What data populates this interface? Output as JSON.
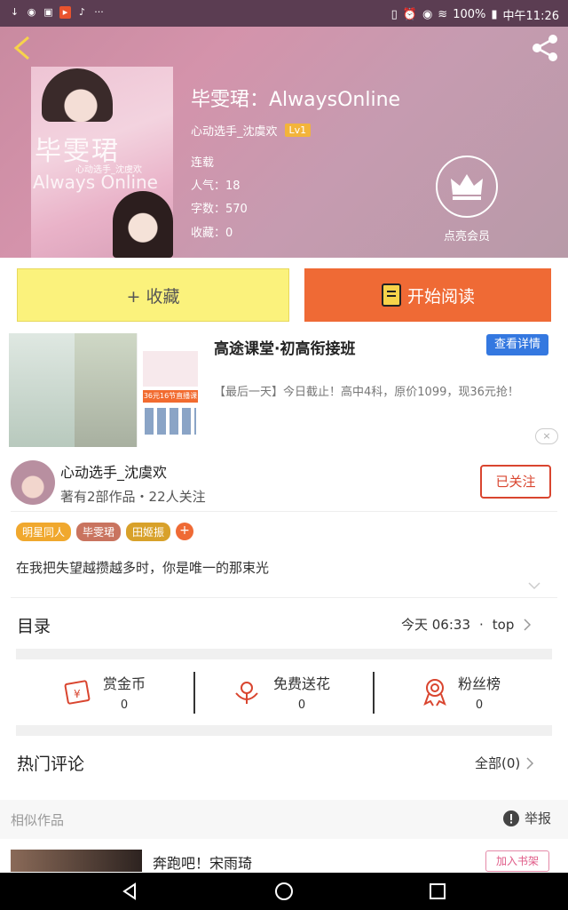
{
  "status_bar": {
    "battery": "100%",
    "time": "中午11:26",
    "more": "···"
  },
  "book": {
    "cover_text_main": "毕雯珺",
    "cover_text_sub": "心动选手_沈虞欢",
    "cover_text_en": "Always Online",
    "title": "毕雯珺：AlwaysOnline",
    "author": "心动选手_沈虞欢",
    "level": "Lv1",
    "status": "连载",
    "popularity": "人气：18",
    "word_count": "字数：570",
    "collections": "收藏：0"
  },
  "vip": {
    "label": "点亮会员"
  },
  "actions": {
    "collect_label": "+ 收藏",
    "read_label": "开始阅读"
  },
  "ad": {
    "title": "高途课堂·初高衔接班",
    "button": "查看详情",
    "description": "【最后一天】今日截止！高中4科，原价1099，现36元抢！",
    "close": "×",
    "banner_price": "36元16节直播课"
  },
  "author_card": {
    "name": "心动选手_沈虞欢",
    "stats": "著有2部作品・22人关注",
    "follow_label": "已关注"
  },
  "tags": [
    {
      "label": "明星同人",
      "color": "#f0a82e"
    },
    {
      "label": "毕雯珺",
      "color": "#c9745f"
    },
    {
      "label": "田姬振",
      "color": "#d8a12a"
    }
  ],
  "intro": "在我把失望越攒越多时，你是唯一的那束光",
  "toc": {
    "title": "目录",
    "updated": "今天 06:33",
    "dot": "·",
    "latest": "top"
  },
  "stats": [
    {
      "label": "赏金币",
      "value": "0",
      "icon": "coin-icon"
    },
    {
      "label": "免费送花",
      "value": "0",
      "icon": "flower-icon"
    },
    {
      "label": "粉丝榜",
      "value": "0",
      "icon": "medal-icon"
    }
  ],
  "comments": {
    "title": "热门评论",
    "all_label": "全部(0)"
  },
  "similar": {
    "title": "相似作品",
    "report_label": "举报"
  },
  "recommend": {
    "title": "奔跑吧！宋雨琦",
    "button": "加入书架"
  },
  "colors": {
    "accent_orange": "#ef6a35",
    "collect_yellow": "#fbf27c",
    "follow_red": "#d9452f",
    "ad_blue": "#3478e0"
  }
}
